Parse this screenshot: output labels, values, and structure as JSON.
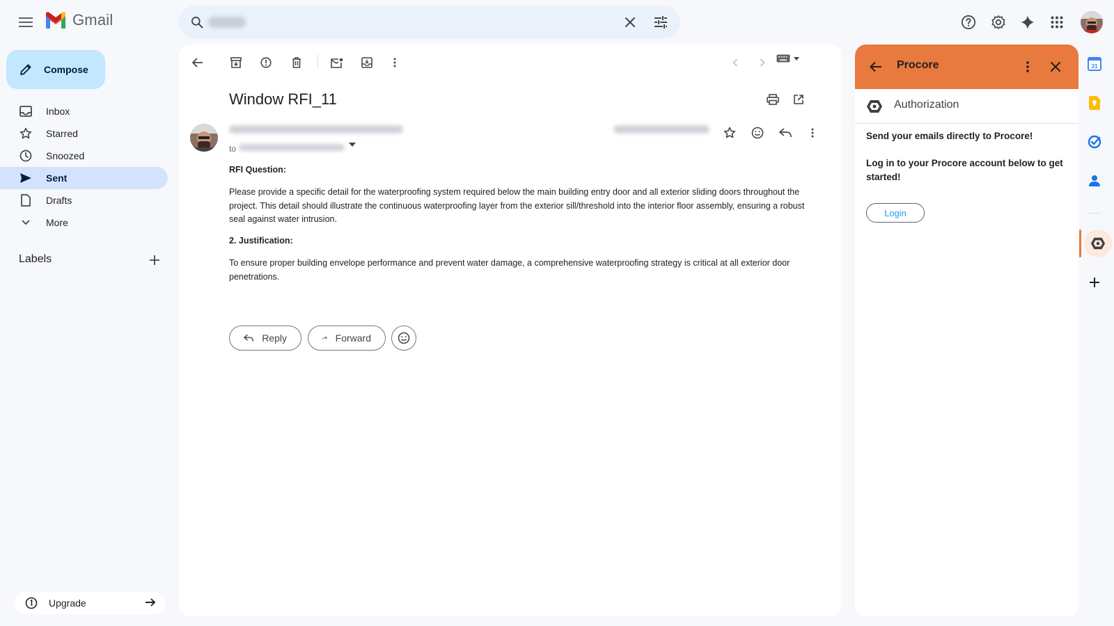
{
  "app": {
    "name": "Gmail"
  },
  "search": {
    "placeholder": "",
    "value": ""
  },
  "compose": {
    "label": "Compose"
  },
  "nav": {
    "items": [
      {
        "id": "inbox",
        "label": "Inbox",
        "icon": "inbox-icon"
      },
      {
        "id": "starred",
        "label": "Starred",
        "icon": "star-icon"
      },
      {
        "id": "snoozed",
        "label": "Snoozed",
        "icon": "clock-icon"
      },
      {
        "id": "sent",
        "label": "Sent",
        "icon": "send-icon",
        "active": true
      },
      {
        "id": "drafts",
        "label": "Drafts",
        "icon": "draft-icon"
      },
      {
        "id": "more",
        "label": "More",
        "icon": "chevron-down-icon"
      }
    ],
    "labels_title": "Labels",
    "upgrade_label": "Upgrade"
  },
  "email": {
    "subject": "Window RFI_11",
    "to_prefix": "to",
    "section1_heading": "RFI Question:",
    "section1_body": "Please provide a specific detail for the waterproofing system required below the main building entry door and all exterior sliding doors throughout the project. This detail should illustrate the continuous waterproofing layer from the exterior sill/threshold into the interior floor assembly, ensuring a robust seal against water intrusion.",
    "section2_heading": "2. Justification:",
    "section2_body": "To ensure proper building envelope performance and prevent water damage, a comprehensive waterproofing strategy is critical at all exterior door penetrations.",
    "reply_label": "Reply",
    "forward_label": "Forward"
  },
  "side_panel": {
    "title": "Procore",
    "header_color": "#e8793f",
    "auth_label": "Authorization",
    "line1": "Send your emails directly to Procore!",
    "line2": "Log in to your Procore account below to get started!",
    "login_label": "Login"
  },
  "colors": {
    "compose_bg": "#c2e7ff",
    "active_nav_bg": "#d3e3fd",
    "procore_orange": "#e8793f",
    "login_text": "#1a9ee5"
  }
}
